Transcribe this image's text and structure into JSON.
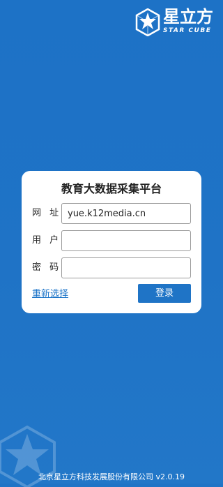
{
  "logo": {
    "name_cn": "星立方",
    "name_en": "STAR CUBE"
  },
  "card": {
    "title": "教育大数据采集平台",
    "fields": [
      {
        "label": "网 址",
        "value": "yue.k12media.cn",
        "placeholder": ""
      },
      {
        "label": "用 户",
        "value": "",
        "placeholder": ""
      },
      {
        "label": "密 码",
        "value": "",
        "placeholder": ""
      }
    ],
    "reselect_label": "重新选择",
    "login_label": "登录"
  },
  "footer": {
    "text": "北京星立方科技发展股份有限公司 v2.0.19"
  },
  "colors": {
    "background": "#1f74c6",
    "button": "#1f74c6",
    "link": "#1a73c8"
  }
}
